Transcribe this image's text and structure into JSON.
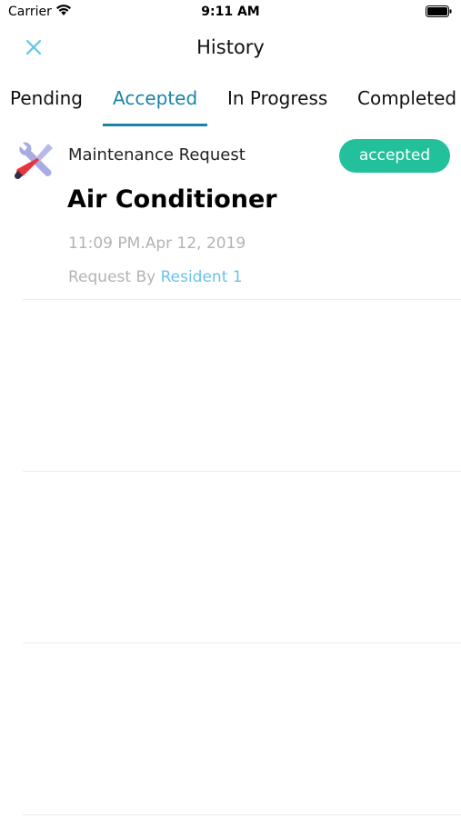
{
  "status_bar": {
    "carrier": "Carrier",
    "time": "9:11 AM"
  },
  "nav": {
    "title": "History",
    "close_icon": "close-icon",
    "accent_color": "#5fc6ea"
  },
  "tabs": [
    {
      "label": "Pending",
      "active": false
    },
    {
      "label": "Accepted",
      "active": true
    },
    {
      "label": "In Progress",
      "active": false
    },
    {
      "label": "Completed",
      "active": false
    }
  ],
  "requests": [
    {
      "type": "Maintenance Request",
      "status": "accepted",
      "title": "Air Conditioner",
      "timestamp": "11:09 PM.Apr 12, 2019",
      "requested_by_label": "Request By",
      "requester": "Resident 1",
      "icon": "tools-icon"
    }
  ],
  "colors": {
    "active_tab": "#1a84a8",
    "badge": "#22c19c",
    "muted_text": "#b3b3b3",
    "link": "#6cc3e6"
  }
}
